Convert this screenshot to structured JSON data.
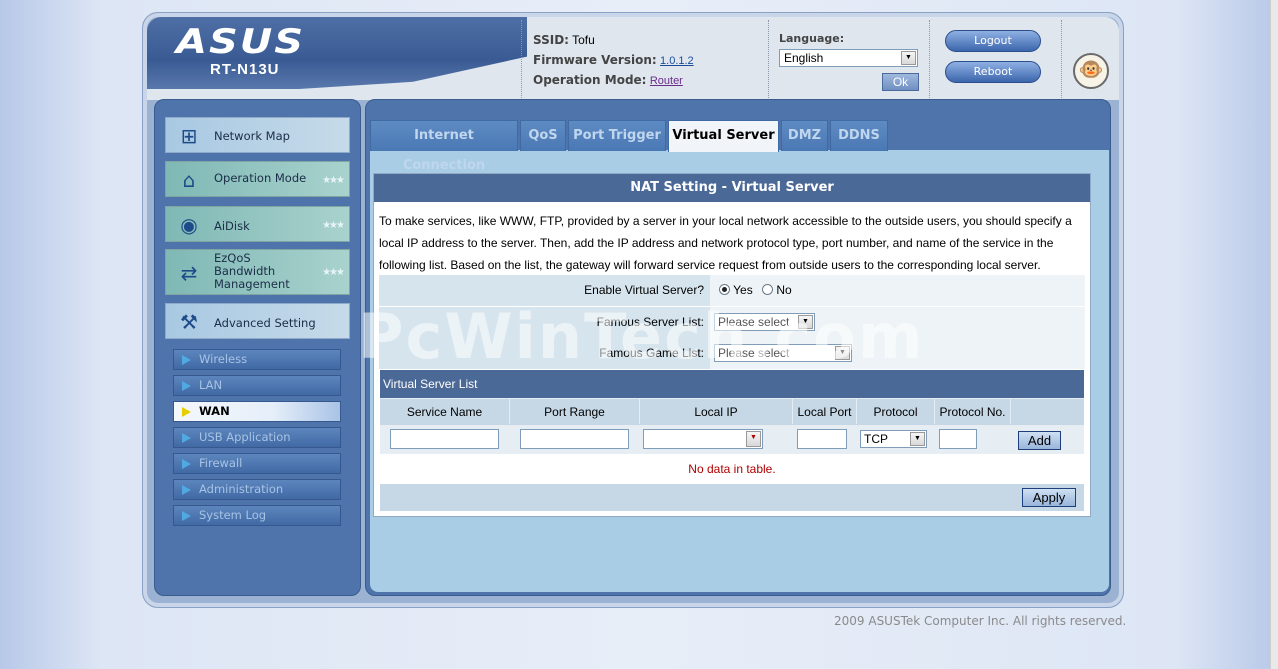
{
  "brand": {
    "logo": "ASUS",
    "model": "RT-N13U"
  },
  "info": {
    "ssid_label": "SSID:",
    "ssid": "Tofu",
    "firmware_label": "Firmware Version:",
    "firmware": "1.0.1.2",
    "opmode_label": "Operation Mode:",
    "opmode": "Router"
  },
  "language": {
    "label": "Language:",
    "selected": "English",
    "ok": "Ok"
  },
  "buttons": {
    "logout": "Logout",
    "reboot": "Reboot"
  },
  "sidebar": {
    "main_items": [
      {
        "label": "Network Map",
        "icon": "network-map-icon"
      },
      {
        "label": "Operation Mode",
        "icon": "router-icon"
      },
      {
        "label": "AiDisk",
        "icon": "disk-icon"
      },
      {
        "label": "EzQoS\nBandwidth\nManagement",
        "icon": "bandwidth-icon"
      },
      {
        "label": "Advanced Setting",
        "icon": "tools-icon"
      }
    ],
    "sub_items": [
      {
        "label": "Wireless"
      },
      {
        "label": "LAN"
      },
      {
        "label": "WAN",
        "active": true
      },
      {
        "label": "USB Application"
      },
      {
        "label": "Firewall"
      },
      {
        "label": "Administration"
      },
      {
        "label": "System Log"
      }
    ]
  },
  "tabs": [
    {
      "label": "Internet Connection"
    },
    {
      "label": "QoS"
    },
    {
      "label": "Port Trigger"
    },
    {
      "label": "Virtual Server",
      "active": true
    },
    {
      "label": "DMZ"
    },
    {
      "label": "DDNS"
    }
  ],
  "content": {
    "title": "NAT Setting - Virtual Server",
    "description": "To make services, like WWW, FTP, provided by a server in your local network accessible to the outside users, you should specify a local IP address to the server. Then, add the IP address and network protocol type, port number, and name of the service in the following list. Based on the list, the gateway will forward service request from outside users to the corresponding local server.",
    "enable_label": "Enable Virtual Server?",
    "enable_yes": "Yes",
    "enable_no": "No",
    "enable_value": "Yes",
    "famous_server_label": "Famous Server List:",
    "famous_server_value": "Please select",
    "famous_game_label": "Famous Game List:",
    "famous_game_value": "Please select",
    "list_title": "Virtual Server List",
    "columns": [
      "Service Name",
      "Port Range",
      "Local IP",
      "Local Port",
      "Protocol",
      "Protocol No."
    ],
    "protocol_value": "TCP",
    "add": "Add",
    "empty": "No data in table.",
    "apply": "Apply"
  },
  "footer": "2009 ASUSTek Computer Inc. All rights reserved.",
  "watermark": "PcWinTech.com"
}
